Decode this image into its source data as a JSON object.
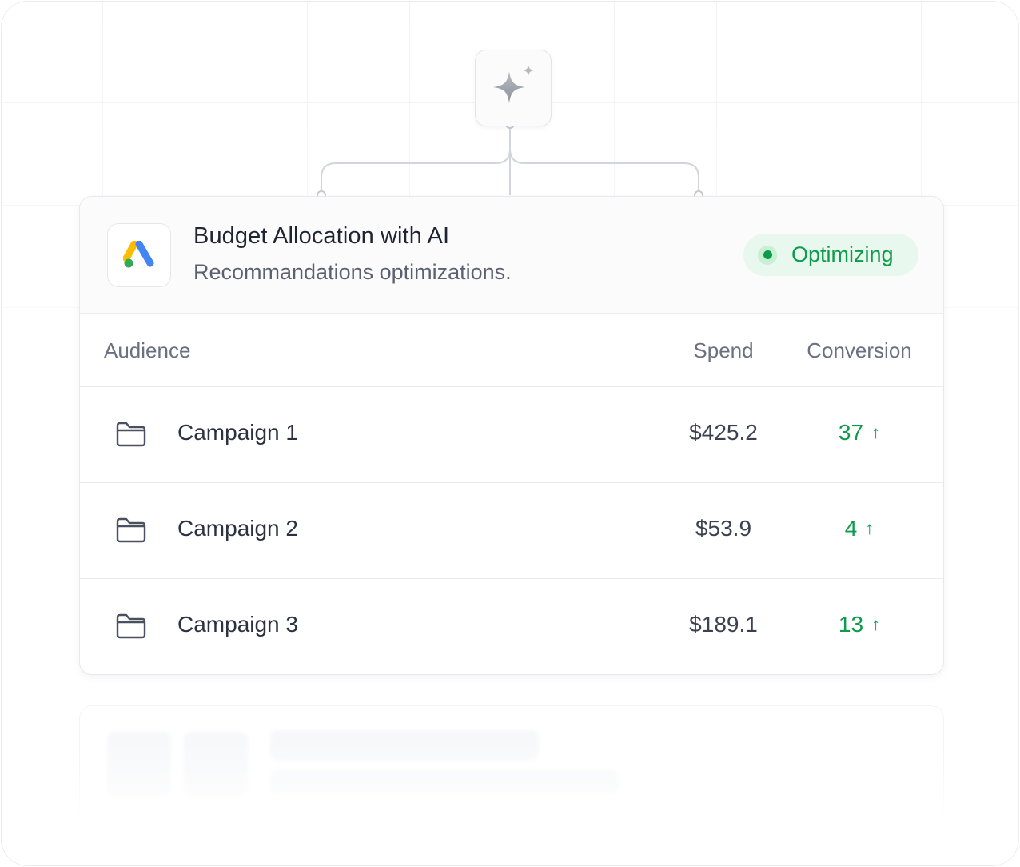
{
  "card": {
    "title": "Budget Allocation with AI",
    "subtitle": "Recommandations optimizations.",
    "status": "Optimizing",
    "logo_icon": "google-ads-logo"
  },
  "table": {
    "headers": {
      "audience": "Audience",
      "spend": "Spend",
      "conversion": "Conversion"
    },
    "rows": [
      {
        "name": "Campaign 1",
        "spend": "$425.2",
        "conversion": "37",
        "trend": "↑"
      },
      {
        "name": "Campaign 2",
        "spend": "$53.9",
        "conversion": "4",
        "trend": "↑"
      },
      {
        "name": "Campaign 3",
        "spend": "$189.1",
        "conversion": "13",
        "trend": "↑"
      }
    ]
  },
  "colors": {
    "accent_green": "#0f9b4c",
    "pill_bg": "#e9f8ee",
    "text_primary": "#1f2433",
    "text_secondary": "#5b6171"
  },
  "icons": {
    "ai": "sparkle-icon",
    "row": "folder-icon",
    "trend": "arrow-up-icon"
  }
}
